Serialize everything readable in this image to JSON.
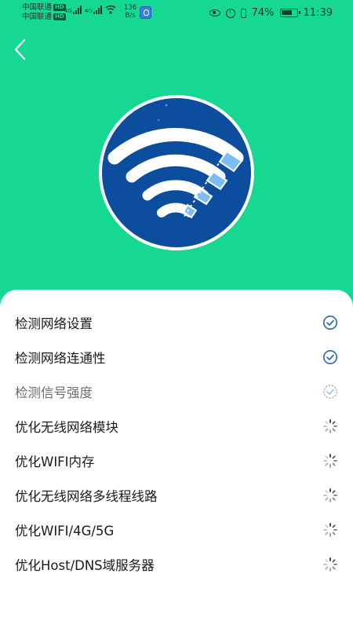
{
  "status_bar": {
    "carrier1": "中国联通",
    "carrier2": "中国联通",
    "hd_badge": "HD",
    "net_type": "4G",
    "net_speed_value": "136",
    "net_speed_unit": "B/s",
    "battery": "74%",
    "time": "11:39"
  },
  "header": {
    "back_icon": "chevron-left-icon",
    "hero_icon": "wifi-icon"
  },
  "checks": [
    {
      "label": "检测网络设置",
      "status": "done"
    },
    {
      "label": "检测网络连通性",
      "status": "done"
    },
    {
      "label": "检测信号强度",
      "status": "running"
    },
    {
      "label": "优化无线网络模块",
      "status": "pending"
    },
    {
      "label": "优化WIFI内存",
      "status": "pending"
    },
    {
      "label": "优化无线网络多线程线路",
      "status": "pending"
    },
    {
      "label": "优化WIFI/4G/5G",
      "status": "pending"
    },
    {
      "label": "优化Host/DNS域服务器",
      "status": "pending"
    }
  ],
  "colors": {
    "accent": "#16d893",
    "circle": "#0c4d9e",
    "check_blue": "#2d67b8"
  }
}
